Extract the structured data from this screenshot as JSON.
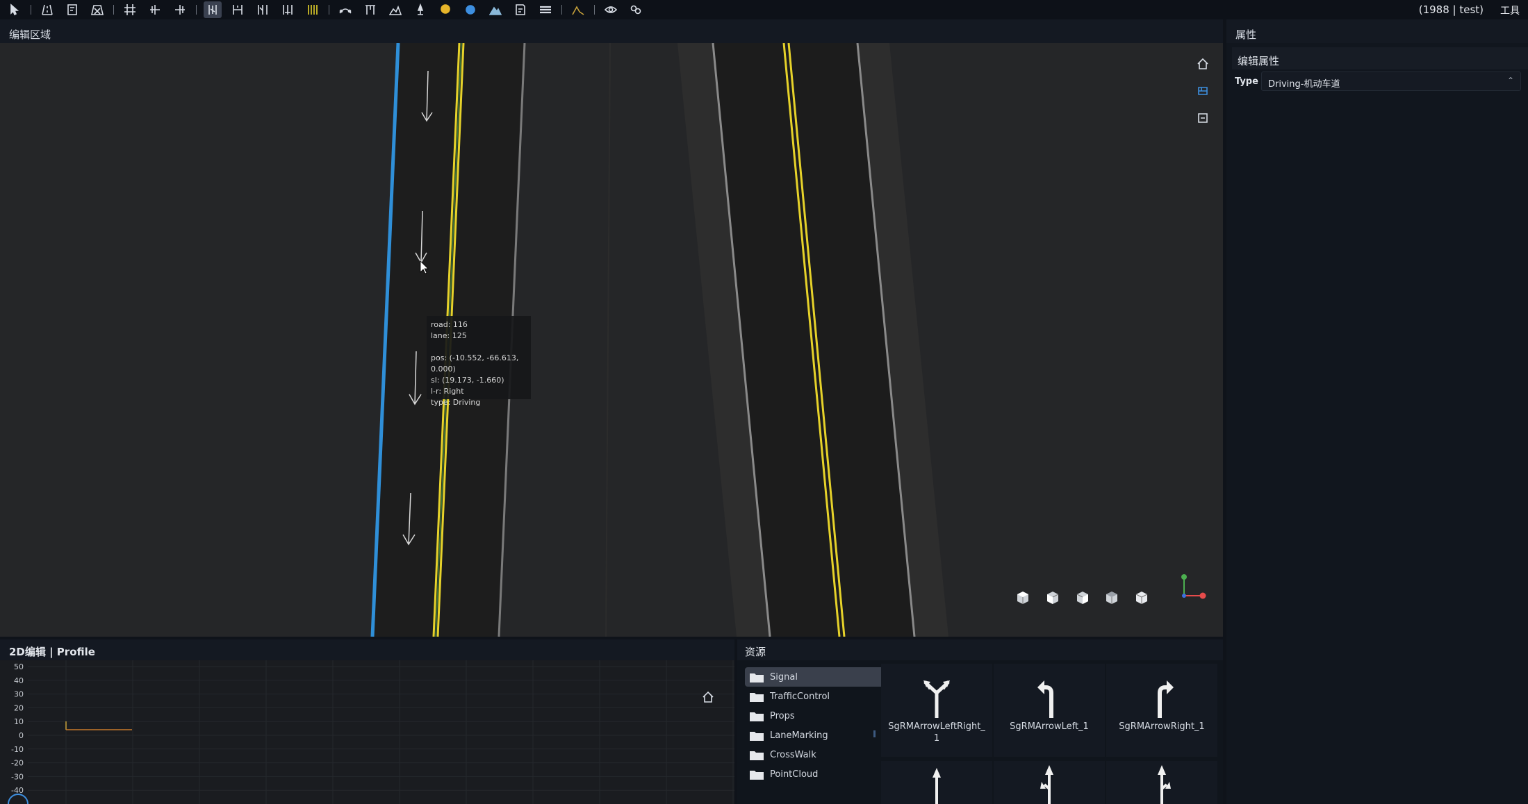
{
  "toolbar": {
    "user": "(1988 | test)",
    "tools_label": "工具",
    "buttons": [
      "select-icon",
      "road-icon",
      "road-edit-icon",
      "road-delete-icon",
      "junction-icon",
      "lane-add-icon",
      "lane-split-icon",
      "lane-active-icon",
      "lane-width-icon",
      "lane-offset-icon",
      "lane-link-icon",
      "lane-marking-icon",
      "curve-icon",
      "gate-icon",
      "elevation-icon",
      "pin-icon",
      "signal-icon",
      "object-icon",
      "mountain-icon",
      "map-icon",
      "bridge-icon",
      "terrain-icon",
      "eye-icon",
      "link-icon"
    ]
  },
  "edit_area": {
    "title": "编辑区域",
    "tooltip": {
      "road": "road: 116",
      "lane": "lane: 125",
      "pos": "pos: (-10.552, -66.613, 0.000)",
      "sl": "sl: (19.173, -1.660)",
      "lr": "l-r: Right",
      "type": "type: Driving"
    },
    "view_icons": [
      "home-icon",
      "perspective-icon",
      "minus-box-icon"
    ],
    "view_cubes": [
      "cube-front-icon",
      "cube-top-icon",
      "cube-left-icon",
      "cube-right-icon",
      "cube-iso-icon"
    ],
    "colors": {
      "lane_line_blue": "#2f8fd8",
      "lane_line_yellow": "#e6d22a",
      "road_dark": "#1c1c1c",
      "background": "#252628"
    }
  },
  "properties": {
    "title": "属性",
    "section": "编辑属性",
    "type_label": "Type",
    "type_value": "Driving-机动车道"
  },
  "profile": {
    "title": "2D编辑 | Profile",
    "y_ticks": [
      "50",
      "40",
      "30",
      "20",
      "10",
      "0",
      "-10",
      "-20",
      "-30",
      "-40"
    ]
  },
  "resources": {
    "title": "资源",
    "folders": [
      "Signal",
      "TrafficControl",
      "Props",
      "LaneMarking",
      "CrossWalk",
      "PointCloud"
    ],
    "selected_folder": "Signal",
    "items": [
      {
        "name_line1": "SgRMArrowLeftRight_",
        "name_line2": "1",
        "icon": "arrow-left-right-icon"
      },
      {
        "name_line1": "SgRMArrowLeft_1",
        "name_line2": "",
        "icon": "arrow-left-icon"
      },
      {
        "name_line1": "SgRMArrowRight_1",
        "name_line2": "",
        "icon": "arrow-right-icon"
      }
    ]
  }
}
